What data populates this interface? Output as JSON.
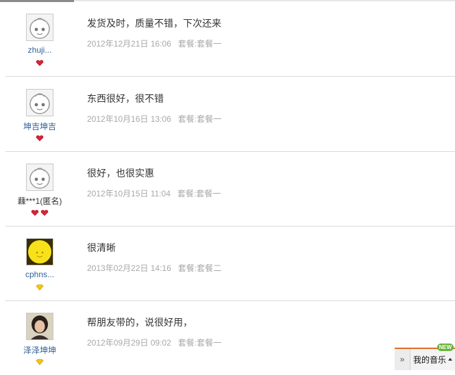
{
  "reviews": [
    {
      "username": "zhuji...",
      "comment": "发货及时，质量不错，下次还来",
      "date": "2012年12月21日 16:06",
      "package": "套餐:套餐一",
      "avatar": "default-face-avatar",
      "badge": "red-heart-icon",
      "badge_count": 1
    },
    {
      "username": "坤吉坤吉",
      "comment": "东西很好，很不错",
      "date": "2012年10月16日 13:06",
      "package": "套餐:套餐一",
      "avatar": "default-face-avatar",
      "badge": "red-heart-icon",
      "badge_count": 1
    },
    {
      "username": "蕀***1(匿名)",
      "comment": "很好，也很实惠",
      "date": "2012年10月15日 11:04",
      "package": "套餐:套餐一",
      "avatar": "default-face-avatar",
      "badge": "red-heart-icon",
      "badge_count": 2
    },
    {
      "username": "cphns...",
      "comment": "很清晰",
      "date": "2013年02月22日 14:16",
      "package": "套餐:套餐二",
      "avatar": "yellow-smiley-avatar",
      "badge": "yellow-diamond-icon",
      "badge_count": 1
    },
    {
      "username": "泽泽坤坤",
      "comment": "帮朋友带的，说很好用，",
      "date": "2012年09月29日 09:02",
      "package": "套餐:套餐一",
      "avatar": "photo-avatar",
      "badge": "yellow-diamond-icon",
      "badge_count": 1
    }
  ],
  "music_widget": {
    "label": "我的音乐",
    "new_badge": "NEW"
  },
  "colors": {
    "username": "#2f5f9a",
    "meta": "#a8a8a8",
    "accent_bar": "#e06a2a",
    "new_badge": "#67b33a"
  }
}
